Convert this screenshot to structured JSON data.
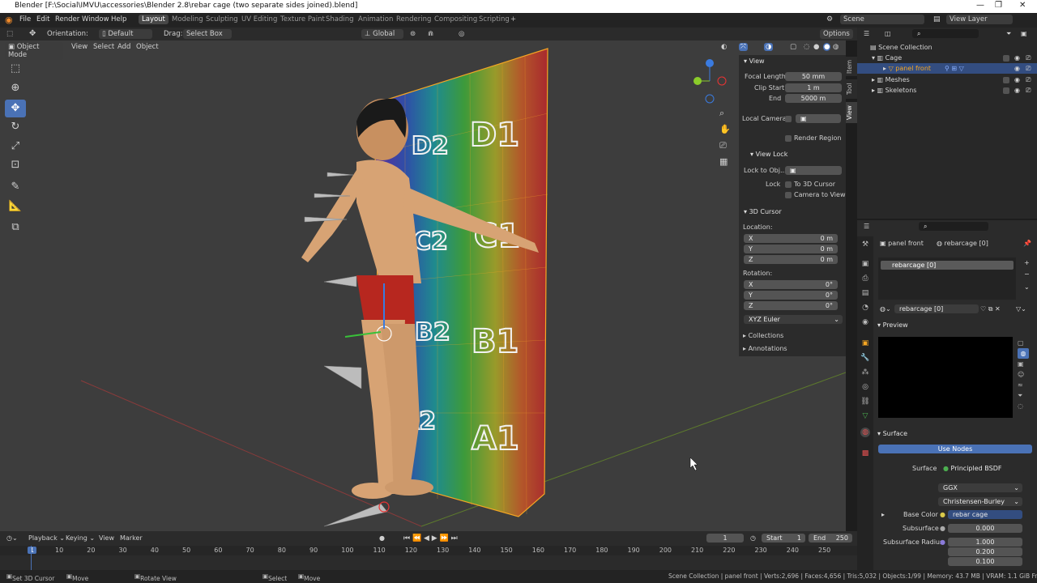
{
  "window": {
    "title": "Blender [F:\\Social\\IMVU\\accessories\\Blender 2.8\\rebar cage (two separate sides joined).blend]"
  },
  "menu": [
    "File",
    "Edit",
    "Render",
    "Window",
    "Help"
  ],
  "workspaces": [
    "Layout",
    "Modeling",
    "Sculpting",
    "UV Editing",
    "Texture Paint",
    "Shading",
    "Animation",
    "Rendering",
    "Compositing",
    "Scripting"
  ],
  "scene": {
    "scene_name": "Scene",
    "view_layer": "View Layer"
  },
  "toolhdr": {
    "orientation_label": "Orientation:",
    "orientation_value": "Default",
    "drag_label": "Drag:",
    "drag_value": "Select Box",
    "transform": "Global",
    "options": "Options"
  },
  "viewport_header": {
    "mode": "Object Mode",
    "view": "View",
    "select": "Select",
    "add": "Add",
    "object": "Object"
  },
  "npanel": {
    "view_header": "View",
    "focal_label": "Focal Length",
    "focal_value": "50 mm",
    "clip_start_label": "Clip Start",
    "clip_start_value": "1 m",
    "end_label": "End",
    "end_value": "5000 m",
    "local_camera": "Local Camera",
    "render_region": "Render Region",
    "view_lock_header": "View Lock",
    "lock_to_obj": "Lock to Obj...",
    "lock_label": "Lock",
    "to_3d_cursor": "To 3D Cursor",
    "camera_to_view": "Camera to View",
    "cursor_header": "3D Cursor",
    "location_label": "Location:",
    "loc_x_label": "X",
    "loc_x": "0 m",
    "loc_y_label": "Y",
    "loc_y": "0 m",
    "loc_z_label": "Z",
    "loc_z": "0 m",
    "rotation_label": "Rotation:",
    "rot_x_label": "X",
    "rot_x": "0°",
    "rot_y_label": "Y",
    "rot_y": "0°",
    "rot_z_label": "Z",
    "rot_z": "0°",
    "rot_mode": "XYZ Euler",
    "collections": "Collections",
    "annotations": "Annotations"
  },
  "side_tabs": [
    "Item",
    "Tool",
    "View"
  ],
  "outliner": {
    "root": "Scene Collection",
    "items": [
      {
        "label": "Cage"
      },
      {
        "label": "panel front"
      },
      {
        "label": "Meshes"
      },
      {
        "label": "Skeletons"
      }
    ]
  },
  "properties": {
    "object_name": "panel front",
    "material_name": "rebarcage [0]",
    "slot_name": "rebarcage [0]",
    "material_field": "rebarcage [0]",
    "preview_header": "Preview",
    "surface_header": "Surface",
    "use_nodes": "Use Nodes",
    "surface_label": "Surface",
    "surface_value": "Principled BSDF",
    "distribution": "GGX",
    "subsurface_method": "Christensen-Burley",
    "base_color_label": "Base Color",
    "base_color_value": "rebar cage",
    "subsurface_label": "Subsurface",
    "subsurface_value": "0.000",
    "subsurface_radius_label": "Subsurface Radius",
    "radius_values": [
      "1.000",
      "0.200",
      "0.100"
    ]
  },
  "timeline": {
    "playback": "Playback",
    "keying": "Keying",
    "view": "View",
    "marker": "Marker",
    "current_frame": "1",
    "start_label": "Start",
    "start_value": "1",
    "end_label": "End",
    "end_value": "250",
    "ruler": [
      "1",
      "10",
      "20",
      "30",
      "40",
      "50",
      "60",
      "70",
      "80",
      "90",
      "100",
      "110",
      "120",
      "130",
      "140",
      "150",
      "160",
      "170",
      "180",
      "190",
      "200",
      "210",
      "220",
      "230",
      "240",
      "250"
    ]
  },
  "statusbar": {
    "hint1": "Set 3D Cursor",
    "hint2": "Move",
    "hint3": "Rotate View",
    "hint4": "Select",
    "hint5": "Move",
    "stats": "Scene Collection | panel front | Verts:2,696 | Faces:4,656 | Tris:5,032 | Objects:1/99 | Memory: 43.7 MB | VRAM: 1.1 GiB Free | 2.93.4"
  },
  "panel_letters": [
    "D1",
    "D2",
    "C1",
    "C2",
    "B1",
    "B2",
    "A1",
    "A2"
  ],
  "colors": {
    "accent": "#4a72b6",
    "selection": "#f5a623",
    "viewport_bg": "#3d3d3d"
  }
}
